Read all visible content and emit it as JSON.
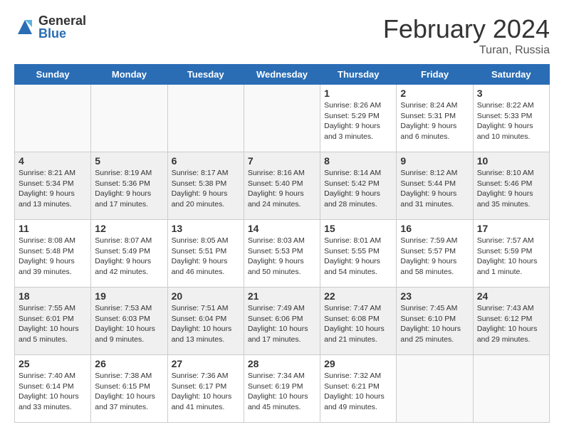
{
  "logo": {
    "general": "General",
    "blue": "Blue"
  },
  "title": "February 2024",
  "subtitle": "Turan, Russia",
  "days_of_week": [
    "Sunday",
    "Monday",
    "Tuesday",
    "Wednesday",
    "Thursday",
    "Friday",
    "Saturday"
  ],
  "weeks": [
    [
      {
        "day": "",
        "info": ""
      },
      {
        "day": "",
        "info": ""
      },
      {
        "day": "",
        "info": ""
      },
      {
        "day": "",
        "info": ""
      },
      {
        "day": "1",
        "info": "Sunrise: 8:26 AM\nSunset: 5:29 PM\nDaylight: 9 hours\nand 3 minutes."
      },
      {
        "day": "2",
        "info": "Sunrise: 8:24 AM\nSunset: 5:31 PM\nDaylight: 9 hours\nand 6 minutes."
      },
      {
        "day": "3",
        "info": "Sunrise: 8:22 AM\nSunset: 5:33 PM\nDaylight: 9 hours\nand 10 minutes."
      }
    ],
    [
      {
        "day": "4",
        "info": "Sunrise: 8:21 AM\nSunset: 5:34 PM\nDaylight: 9 hours\nand 13 minutes."
      },
      {
        "day": "5",
        "info": "Sunrise: 8:19 AM\nSunset: 5:36 PM\nDaylight: 9 hours\nand 17 minutes."
      },
      {
        "day": "6",
        "info": "Sunrise: 8:17 AM\nSunset: 5:38 PM\nDaylight: 9 hours\nand 20 minutes."
      },
      {
        "day": "7",
        "info": "Sunrise: 8:16 AM\nSunset: 5:40 PM\nDaylight: 9 hours\nand 24 minutes."
      },
      {
        "day": "8",
        "info": "Sunrise: 8:14 AM\nSunset: 5:42 PM\nDaylight: 9 hours\nand 28 minutes."
      },
      {
        "day": "9",
        "info": "Sunrise: 8:12 AM\nSunset: 5:44 PM\nDaylight: 9 hours\nand 31 minutes."
      },
      {
        "day": "10",
        "info": "Sunrise: 8:10 AM\nSunset: 5:46 PM\nDaylight: 9 hours\nand 35 minutes."
      }
    ],
    [
      {
        "day": "11",
        "info": "Sunrise: 8:08 AM\nSunset: 5:48 PM\nDaylight: 9 hours\nand 39 minutes."
      },
      {
        "day": "12",
        "info": "Sunrise: 8:07 AM\nSunset: 5:49 PM\nDaylight: 9 hours\nand 42 minutes."
      },
      {
        "day": "13",
        "info": "Sunrise: 8:05 AM\nSunset: 5:51 PM\nDaylight: 9 hours\nand 46 minutes."
      },
      {
        "day": "14",
        "info": "Sunrise: 8:03 AM\nSunset: 5:53 PM\nDaylight: 9 hours\nand 50 minutes."
      },
      {
        "day": "15",
        "info": "Sunrise: 8:01 AM\nSunset: 5:55 PM\nDaylight: 9 hours\nand 54 minutes."
      },
      {
        "day": "16",
        "info": "Sunrise: 7:59 AM\nSunset: 5:57 PM\nDaylight: 9 hours\nand 58 minutes."
      },
      {
        "day": "17",
        "info": "Sunrise: 7:57 AM\nSunset: 5:59 PM\nDaylight: 10 hours\nand 1 minute."
      }
    ],
    [
      {
        "day": "18",
        "info": "Sunrise: 7:55 AM\nSunset: 6:01 PM\nDaylight: 10 hours\nand 5 minutes."
      },
      {
        "day": "19",
        "info": "Sunrise: 7:53 AM\nSunset: 6:03 PM\nDaylight: 10 hours\nand 9 minutes."
      },
      {
        "day": "20",
        "info": "Sunrise: 7:51 AM\nSunset: 6:04 PM\nDaylight: 10 hours\nand 13 minutes."
      },
      {
        "day": "21",
        "info": "Sunrise: 7:49 AM\nSunset: 6:06 PM\nDaylight: 10 hours\nand 17 minutes."
      },
      {
        "day": "22",
        "info": "Sunrise: 7:47 AM\nSunset: 6:08 PM\nDaylight: 10 hours\nand 21 minutes."
      },
      {
        "day": "23",
        "info": "Sunrise: 7:45 AM\nSunset: 6:10 PM\nDaylight: 10 hours\nand 25 minutes."
      },
      {
        "day": "24",
        "info": "Sunrise: 7:43 AM\nSunset: 6:12 PM\nDaylight: 10 hours\nand 29 minutes."
      }
    ],
    [
      {
        "day": "25",
        "info": "Sunrise: 7:40 AM\nSunset: 6:14 PM\nDaylight: 10 hours\nand 33 minutes."
      },
      {
        "day": "26",
        "info": "Sunrise: 7:38 AM\nSunset: 6:15 PM\nDaylight: 10 hours\nand 37 minutes."
      },
      {
        "day": "27",
        "info": "Sunrise: 7:36 AM\nSunset: 6:17 PM\nDaylight: 10 hours\nand 41 minutes."
      },
      {
        "day": "28",
        "info": "Sunrise: 7:34 AM\nSunset: 6:19 PM\nDaylight: 10 hours\nand 45 minutes."
      },
      {
        "day": "29",
        "info": "Sunrise: 7:32 AM\nSunset: 6:21 PM\nDaylight: 10 hours\nand 49 minutes."
      },
      {
        "day": "",
        "info": ""
      },
      {
        "day": "",
        "info": ""
      }
    ]
  ]
}
